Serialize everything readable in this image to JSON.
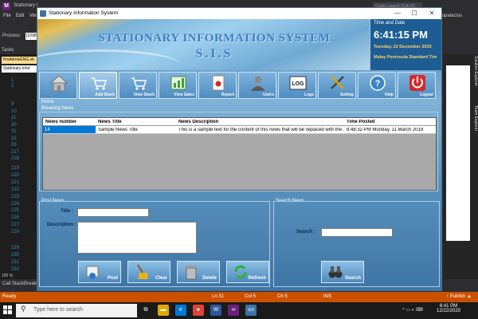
{
  "vs": {
    "logo": "M",
    "window_title": "Stationary I",
    "search_placeholder": "Quick Launch (Ctrl+Q)",
    "user": "enopalacios",
    "menu": [
      "File",
      "Edit",
      "Vie"
    ],
    "process_label": "Process:",
    "process_value": "[1098",
    "tasks_label": "Tasks",
    "file_tab": "frmAdminENG.vb",
    "class_box": "Stationary Infor",
    "line_numbers": [
      "1",
      "2",
      "9",
      "10",
      "11",
      "30",
      "31",
      "32",
      "33",
      "217",
      "218",
      "219",
      "220",
      "221",
      "222",
      "223",
      "224",
      "225",
      "226",
      "227",
      "228",
      "229",
      "230",
      "231",
      "232"
    ],
    "side_tabs": [
      "Solution Explorer",
      "Team Explorer"
    ],
    "zoom": "100 %",
    "bottom_tabs": [
      "Call Stack",
      "Breakp"
    ],
    "status": {
      "ready": "Ready",
      "ln": "Ln 31",
      "col": "Col 5",
      "ch": "Ch 5",
      "ins": "INS",
      "publish": "↑ Publish ▲"
    }
  },
  "taskbar": {
    "search_placeholder": "Type here to search",
    "icons": [
      {
        "name": "task-view-icon",
        "glyph": "⧉",
        "color": "#1a1a1a"
      },
      {
        "name": "file-explorer-icon",
        "glyph": "▬",
        "color": "#e0a800"
      },
      {
        "name": "edge-icon",
        "glyph": "e",
        "color": "#0078d7"
      },
      {
        "name": "chrome-icon",
        "glyph": "●",
        "color": "#db4437"
      },
      {
        "name": "word-icon",
        "glyph": "W",
        "color": "#2b579a"
      },
      {
        "name": "visual-studio-icon",
        "glyph": "∞",
        "color": "#68217a"
      },
      {
        "name": "sis-app-icon",
        "glyph": "SIS",
        "color": "#3b73a8"
      }
    ],
    "tray": "^ ▭ ◐ ⌨",
    "time": "6:41 PM",
    "date": "12/22/2020"
  },
  "app": {
    "title": "Stationary Information System",
    "window_controls": {
      "minimize": "—",
      "maximize": "☐",
      "close": "✕"
    },
    "banner": {
      "title": "STATIONARY INFORMATION SYSTEM",
      "subtitle": "S.I.S"
    },
    "time_panel": {
      "label": "Time and Date",
      "time": "6:41:15 PM",
      "date": "Tuesday, 22 December 2020",
      "zone": "Malay Peninsula Standard Tim"
    },
    "toolbar": [
      {
        "id": "home",
        "label": ""
      },
      {
        "id": "add-stock",
        "label": "Add Stock"
      },
      {
        "id": "view-stock",
        "label": "View Stock"
      },
      {
        "id": "view-sales",
        "label": "View Sales"
      },
      {
        "id": "report",
        "label": "Report"
      },
      {
        "id": "users",
        "label": "Users"
      },
      {
        "id": "logs",
        "label": "Logs"
      },
      {
        "id": "setting",
        "label": "Setting"
      },
      {
        "id": "help",
        "label": "Help"
      },
      {
        "id": "logout",
        "label": "Logout"
      }
    ],
    "home_label": "Home",
    "breaking_news": {
      "label": "Breaking News",
      "columns": [
        "News number",
        "News Title",
        "News Description",
        "Time Posted"
      ],
      "rows": [
        [
          "14",
          "Sample News Title",
          "This is a sample text for the content of this news that will be replaced with the ...",
          "8:48:32 PM Monday, 11 March 2019"
        ]
      ]
    },
    "post_news": {
      "label": "Post News",
      "title_label": "Title :",
      "title_value": "",
      "description_label": "Description :",
      "description_value": "",
      "buttons": {
        "post": "Post",
        "clear": "Clear",
        "delete": "Delete",
        "refresh": "Refresh"
      }
    },
    "search_news": {
      "label": "Search News",
      "search_label": "Search :",
      "search_value": "",
      "button": "Search"
    }
  }
}
